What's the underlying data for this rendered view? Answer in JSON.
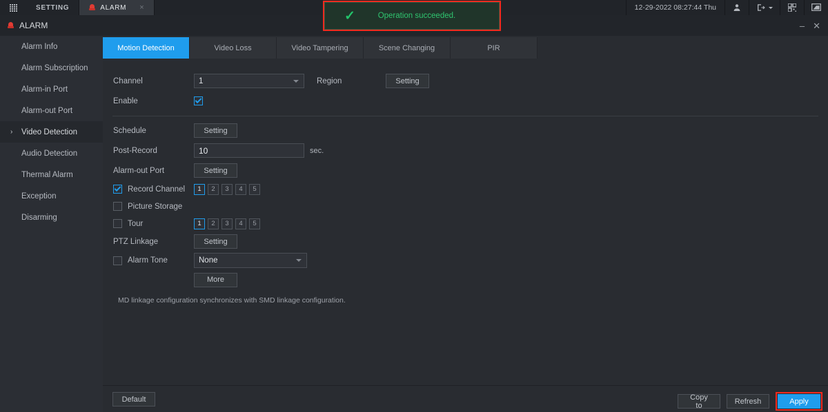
{
  "topbar": {
    "grid_icon": "grid-icon",
    "tabs": [
      {
        "label": "SETTING",
        "active": false,
        "icon": null
      },
      {
        "label": "ALARM",
        "active": true,
        "icon": "alarm-siren-icon",
        "close": "×"
      }
    ],
    "datetime": "12-29-2022 08:27:44 Thu",
    "icons": [
      "user-icon",
      "logout-icon",
      "chevron-down-icon",
      "qr-code-icon",
      "monitor-icon"
    ]
  },
  "banner": {
    "check": "✓",
    "text": "Operation succeeded.",
    "border_color": "#f02a1e",
    "text_color": "#2fc46f"
  },
  "window": {
    "title": "ALARM",
    "minimize": "–",
    "close": "✕"
  },
  "sidebar": {
    "items": [
      {
        "label": "Alarm Info",
        "selected": false
      },
      {
        "label": "Alarm Subscription",
        "selected": false
      },
      {
        "label": "Alarm-in Port",
        "selected": false
      },
      {
        "label": "Alarm-out Port",
        "selected": false
      },
      {
        "label": "Video Detection",
        "selected": true,
        "chevron": "›"
      },
      {
        "label": "Audio Detection",
        "selected": false
      },
      {
        "label": "Thermal Alarm",
        "selected": false
      },
      {
        "label": "Exception",
        "selected": false
      },
      {
        "label": "Disarming",
        "selected": false
      }
    ]
  },
  "tabs": [
    {
      "label": "Motion Detection",
      "active": true
    },
    {
      "label": "Video Loss",
      "active": false
    },
    {
      "label": "Video Tampering",
      "active": false
    },
    {
      "label": "Scene Changing",
      "active": false
    },
    {
      "label": "PIR",
      "active": false
    }
  ],
  "form": {
    "channel_label": "Channel",
    "channel_value": "1",
    "region_label": "Region",
    "region_button": "Setting",
    "enable_label": "Enable",
    "enable_checked": true,
    "schedule_label": "Schedule",
    "schedule_button": "Setting",
    "post_record_label": "Post-Record",
    "post_record_value": "10",
    "post_record_unit": "sec.",
    "alarm_out_label": "Alarm-out Port",
    "alarm_out_button": "Setting",
    "record_channel_label": "Record Channel",
    "record_channel_checked": true,
    "record_channels": [
      "1",
      "2",
      "3",
      "4",
      "5"
    ],
    "record_channel_selected": "1",
    "picture_storage_label": "Picture Storage",
    "picture_storage_checked": false,
    "tour_label": "Tour",
    "tour_checked": false,
    "tour_channels": [
      "1",
      "2",
      "3",
      "4",
      "5"
    ],
    "tour_channel_selected": "1",
    "ptz_label": "PTZ Linkage",
    "ptz_button": "Setting",
    "alarm_tone_label": "Alarm Tone",
    "alarm_tone_checked": false,
    "alarm_tone_value": "None",
    "more_button": "More",
    "note": "MD linkage configuration synchronizes with SMD linkage configuration."
  },
  "footer": {
    "default": "Default",
    "copy_to": "Copy to",
    "refresh": "Refresh",
    "apply": "Apply",
    "apply_color": "#1f9ded",
    "apply_highlight": "#f02a1e"
  }
}
